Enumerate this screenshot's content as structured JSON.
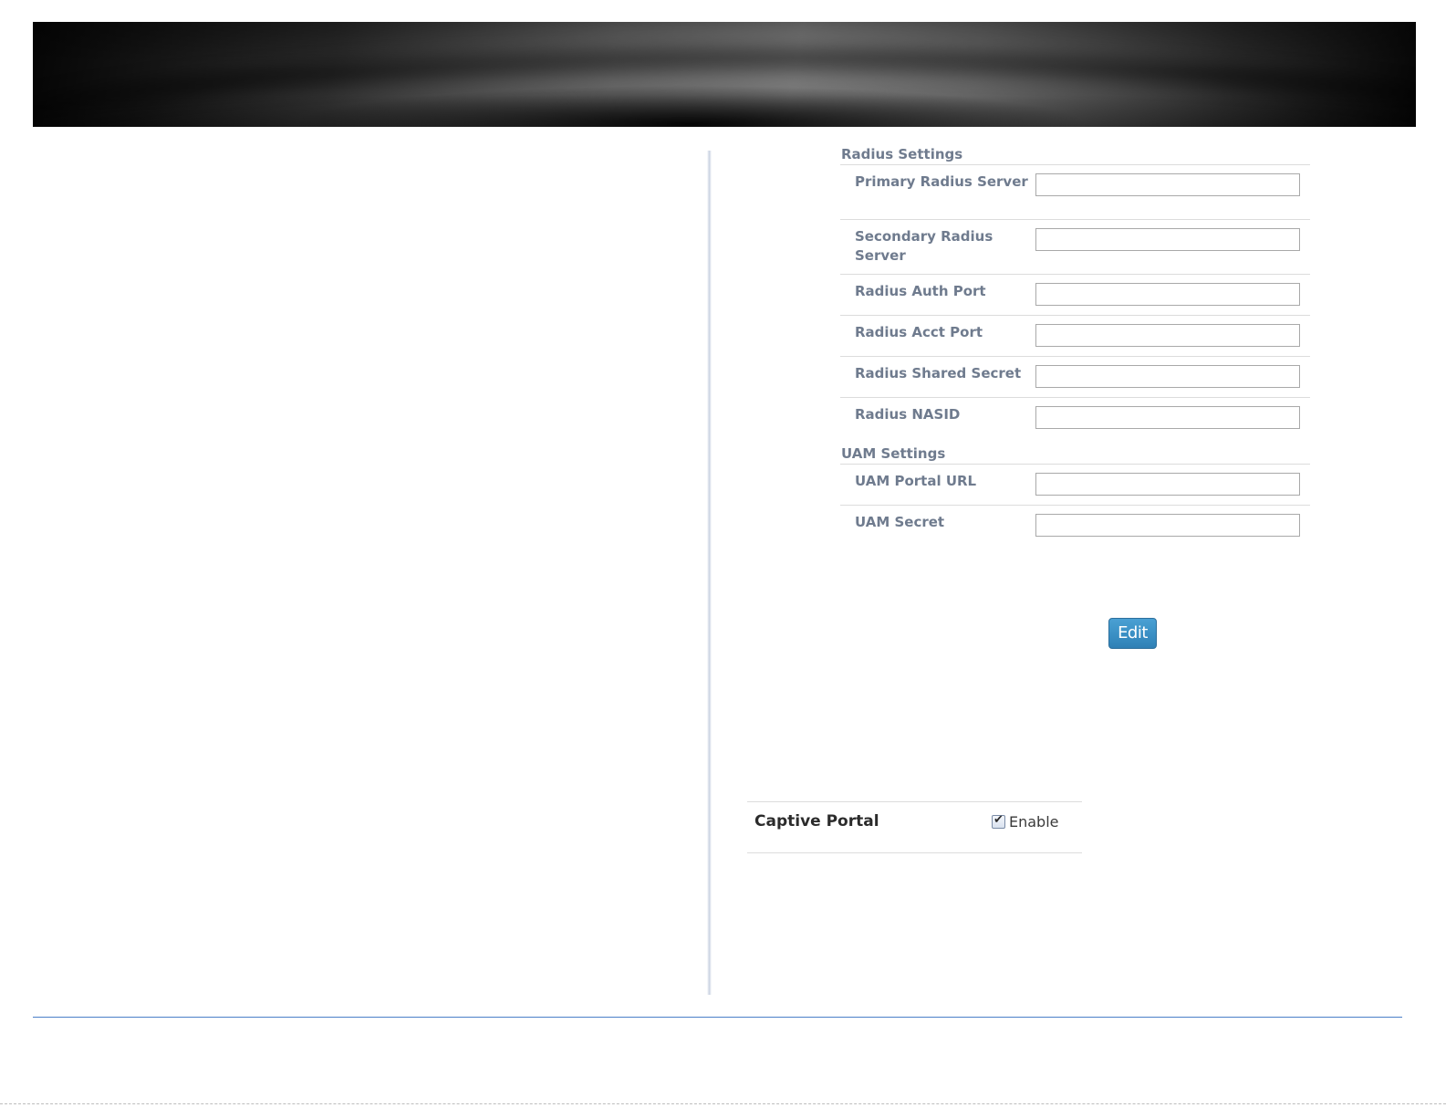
{
  "radius_settings": {
    "header": "Radius Settings",
    "fields": [
      {
        "label": "Primary Radius Server",
        "value": ""
      },
      {
        "label": "Secondary Radius Server",
        "value": ""
      },
      {
        "label": "Radius Auth Port",
        "value": ""
      },
      {
        "label": "Radius Acct Port",
        "value": ""
      },
      {
        "label": "Radius Shared Secret",
        "value": ""
      },
      {
        "label": "Radius NASID",
        "value": ""
      }
    ]
  },
  "uam_settings": {
    "header": "UAM Settings",
    "fields": [
      {
        "label": "UAM Portal URL",
        "value": ""
      },
      {
        "label": "UAM Secret",
        "value": ""
      }
    ]
  },
  "edit_button": {
    "label": "Edit"
  },
  "captive_portal": {
    "label": "Captive Portal",
    "checkbox_label": "Enable",
    "checked": true,
    "check_icon": "check-mark-icon"
  },
  "colors": {
    "label_text": "#6f7b8e",
    "button_bg": "#3a8fc4",
    "footer_line": "#4a7fc8"
  }
}
